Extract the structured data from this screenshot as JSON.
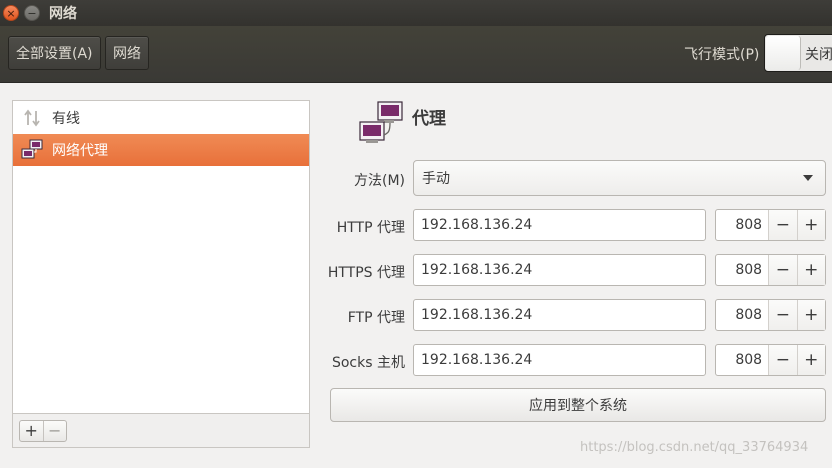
{
  "window": {
    "title": "网络",
    "close_icon": "×",
    "minimize_icon": "−"
  },
  "toolbar": {
    "all_settings": "全部设置(A)",
    "network": "网络",
    "airplane_mode": "飞行模式(P)",
    "airplane_state": "关闭"
  },
  "sidebar": {
    "items": [
      {
        "label": "有线",
        "icon": "wired-arrows-icon",
        "selected": false
      },
      {
        "label": "网络代理",
        "icon": "network-proxy-icon",
        "selected": true
      }
    ],
    "add_label": "+",
    "remove_label": "−"
  },
  "proxy": {
    "title": "代理",
    "method": {
      "label": "方法(M)",
      "value": "手动"
    },
    "fields": [
      {
        "label": "HTTP 代理",
        "host": "192.168.136.24",
        "port": "808"
      },
      {
        "label": "HTTPS 代理",
        "host": "192.168.136.24",
        "port": "808"
      },
      {
        "label": "FTP 代理",
        "host": "192.168.136.24",
        "port": "808"
      },
      {
        "label": "Socks 主机",
        "host": "192.168.136.24",
        "port": "808"
      }
    ],
    "spin_minus": "−",
    "spin_plus": "+",
    "apply_button": "应用到整个系统"
  },
  "watermark": "https://blog.csdn.net/qq_33764934",
  "colors": {
    "accent": "#e8703a",
    "titlebar": "#3a3935",
    "background": "#f2f1f0"
  }
}
